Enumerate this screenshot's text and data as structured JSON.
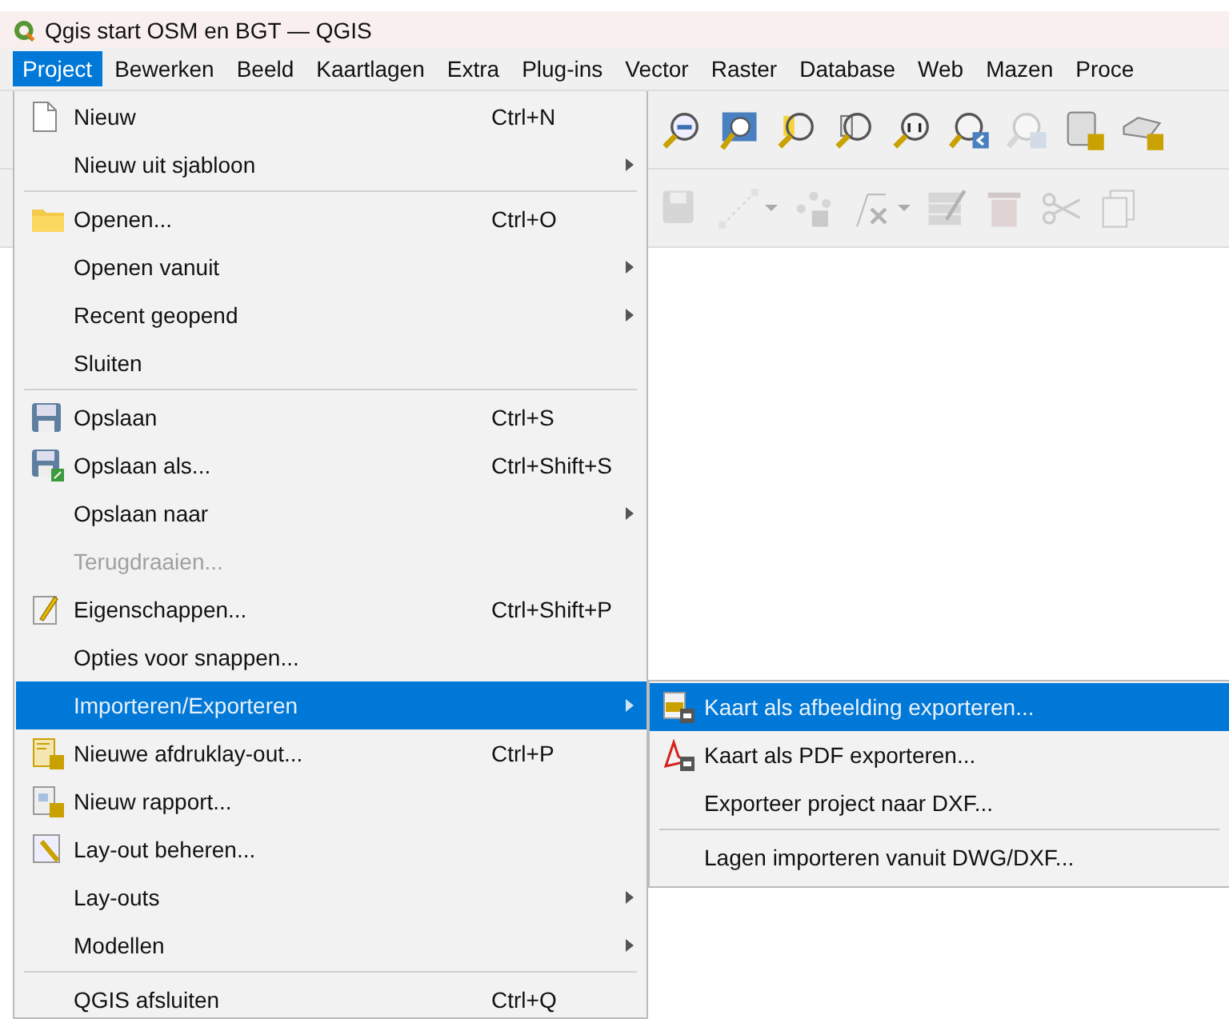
{
  "window": {
    "title": "Qgis start OSM en BGT — QGIS"
  },
  "menu_bar": [
    {
      "label": "Project",
      "selected": true
    },
    {
      "label": "Bewerken",
      "selected": false
    },
    {
      "label": "Beeld",
      "selected": false
    },
    {
      "label": "Kaartlagen",
      "selected": false
    },
    {
      "label": "Extra",
      "selected": false
    },
    {
      "label": "Plug-ins",
      "selected": false
    },
    {
      "label": "Vector",
      "selected": false
    },
    {
      "label": "Raster",
      "selected": false
    },
    {
      "label": "Database",
      "selected": false
    },
    {
      "label": "Web",
      "selected": false
    },
    {
      "label": "Mazen",
      "selected": false
    },
    {
      "label": "Proce",
      "selected": false
    }
  ],
  "project_menu": [
    {
      "kind": "item",
      "label": "Nieuw",
      "shortcut": "Ctrl+N",
      "submenu": false,
      "disabled": false,
      "selected": false
    },
    {
      "kind": "item",
      "label": "Nieuw uit sjabloon",
      "submenu": true,
      "disabled": false,
      "selected": false
    },
    {
      "kind": "separator"
    },
    {
      "kind": "item",
      "label": "Openen...",
      "shortcut": "Ctrl+O",
      "submenu": false,
      "disabled": false,
      "selected": false
    },
    {
      "kind": "item",
      "label": "Openen vanuit",
      "submenu": true,
      "disabled": false,
      "selected": false
    },
    {
      "kind": "item",
      "label": "Recent geopend",
      "submenu": true,
      "disabled": false,
      "selected": false
    },
    {
      "kind": "item",
      "label": "Sluiten",
      "submenu": false,
      "disabled": false,
      "selected": false
    },
    {
      "kind": "separator"
    },
    {
      "kind": "item",
      "label": "Opslaan",
      "shortcut": "Ctrl+S",
      "submenu": false,
      "disabled": false,
      "selected": false
    },
    {
      "kind": "item",
      "label": "Opslaan als...",
      "shortcut": "Ctrl+Shift+S",
      "submenu": false,
      "disabled": false,
      "selected": false
    },
    {
      "kind": "item",
      "label": "Opslaan naar",
      "submenu": true,
      "disabled": false,
      "selected": false
    },
    {
      "kind": "item",
      "label": "Terugdraaien...",
      "submenu": false,
      "disabled": true,
      "selected": false
    },
    {
      "kind": "item",
      "label": "Eigenschappen...",
      "shortcut": "Ctrl+Shift+P",
      "submenu": false,
      "disabled": false,
      "selected": false
    },
    {
      "kind": "item",
      "label": "Opties voor snappen...",
      "submenu": false,
      "disabled": false,
      "selected": false
    },
    {
      "kind": "item",
      "label": "Importeren/Exporteren",
      "submenu": true,
      "disabled": false,
      "selected": true
    },
    {
      "kind": "item",
      "label": "Nieuwe afdruklay-out...",
      "shortcut": "Ctrl+P",
      "submenu": false,
      "disabled": false,
      "selected": false
    },
    {
      "kind": "item",
      "label": "Nieuw rapport...",
      "submenu": false,
      "disabled": false,
      "selected": false
    },
    {
      "kind": "item",
      "label": "Lay-out beheren...",
      "submenu": false,
      "disabled": false,
      "selected": false
    },
    {
      "kind": "item",
      "label": "Lay-outs",
      "submenu": true,
      "disabled": false,
      "selected": false
    },
    {
      "kind": "item",
      "label": "Modellen",
      "submenu": true,
      "disabled": false,
      "selected": false
    },
    {
      "kind": "separator"
    },
    {
      "kind": "item",
      "label": "QGIS afsluiten",
      "shortcut": "Ctrl+Q",
      "submenu": false,
      "disabled": false,
      "selected": false
    }
  ],
  "submenu": [
    {
      "kind": "item",
      "label": "Kaart als afbeelding exporteren...",
      "selected": true
    },
    {
      "kind": "item",
      "label": "Kaart als PDF exporteren...",
      "selected": false
    },
    {
      "kind": "item",
      "label": "Exporteer project naar DXF...",
      "selected": false
    },
    {
      "kind": "separator"
    },
    {
      "kind": "item",
      "label": "Lagen importeren vanuit DWG/DXF...",
      "selected": false
    }
  ]
}
